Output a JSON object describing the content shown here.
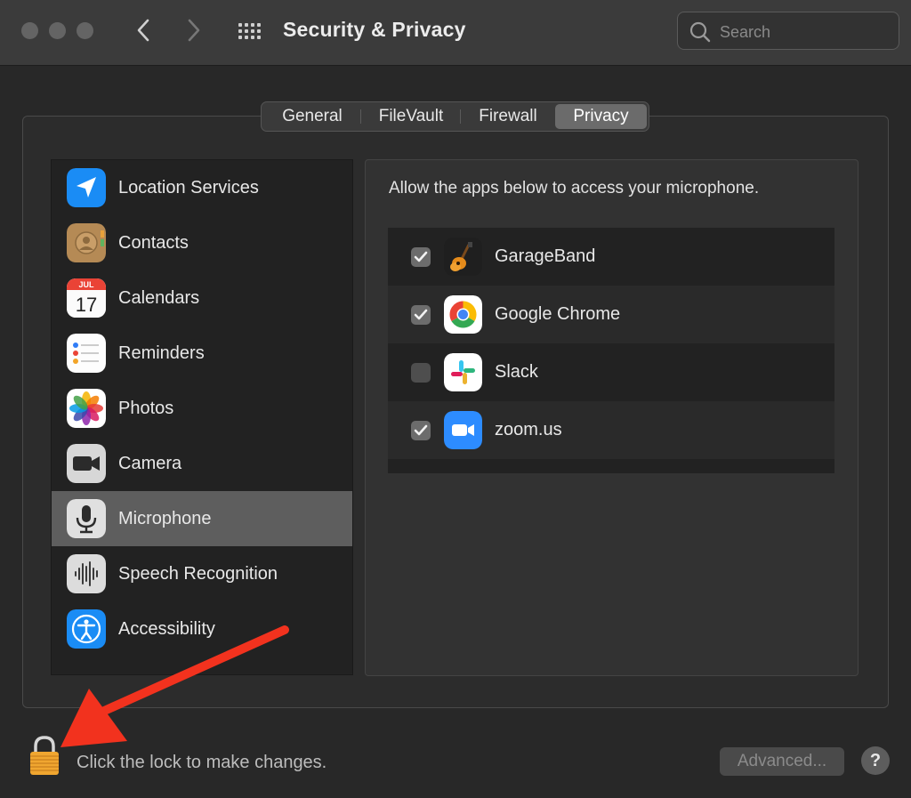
{
  "window": {
    "title": "Security & Privacy"
  },
  "search": {
    "placeholder": "Search",
    "icon": "search-icon"
  },
  "tabs": [
    {
      "label": "General",
      "active": false
    },
    {
      "label": "FileVault",
      "active": false
    },
    {
      "label": "Firewall",
      "active": false
    },
    {
      "label": "Privacy",
      "active": true
    }
  ],
  "sidebar": {
    "items": [
      {
        "label": "Location Services",
        "icon": "location-arrow-icon"
      },
      {
        "label": "Contacts",
        "icon": "contacts-icon"
      },
      {
        "label": "Calendars",
        "icon": "calendar-icon",
        "month": "JUL",
        "day": "17"
      },
      {
        "label": "Reminders",
        "icon": "reminders-icon"
      },
      {
        "label": "Photos",
        "icon": "photos-icon"
      },
      {
        "label": "Camera",
        "icon": "camera-icon"
      },
      {
        "label": "Microphone",
        "icon": "microphone-icon",
        "selected": true
      },
      {
        "label": "Speech Recognition",
        "icon": "waveform-icon"
      },
      {
        "label": "Accessibility",
        "icon": "accessibility-icon"
      }
    ]
  },
  "main": {
    "description": "Allow the apps below to access your microphone.",
    "apps": [
      {
        "name": "GarageBand",
        "checked": true,
        "icon": "garageband-icon"
      },
      {
        "name": "Google Chrome",
        "checked": true,
        "icon": "chrome-icon"
      },
      {
        "name": "Slack",
        "checked": false,
        "icon": "slack-icon"
      },
      {
        "name": "zoom.us",
        "checked": true,
        "icon": "zoom-icon"
      }
    ]
  },
  "footer": {
    "lock_text": "Click the lock to make changes.",
    "advanced_label": "Advanced...",
    "help_label": "?"
  },
  "colors": {
    "annotation_arrow": "#f2321e",
    "lock": "#f0a630",
    "selected_row": "#5e5e5e"
  }
}
